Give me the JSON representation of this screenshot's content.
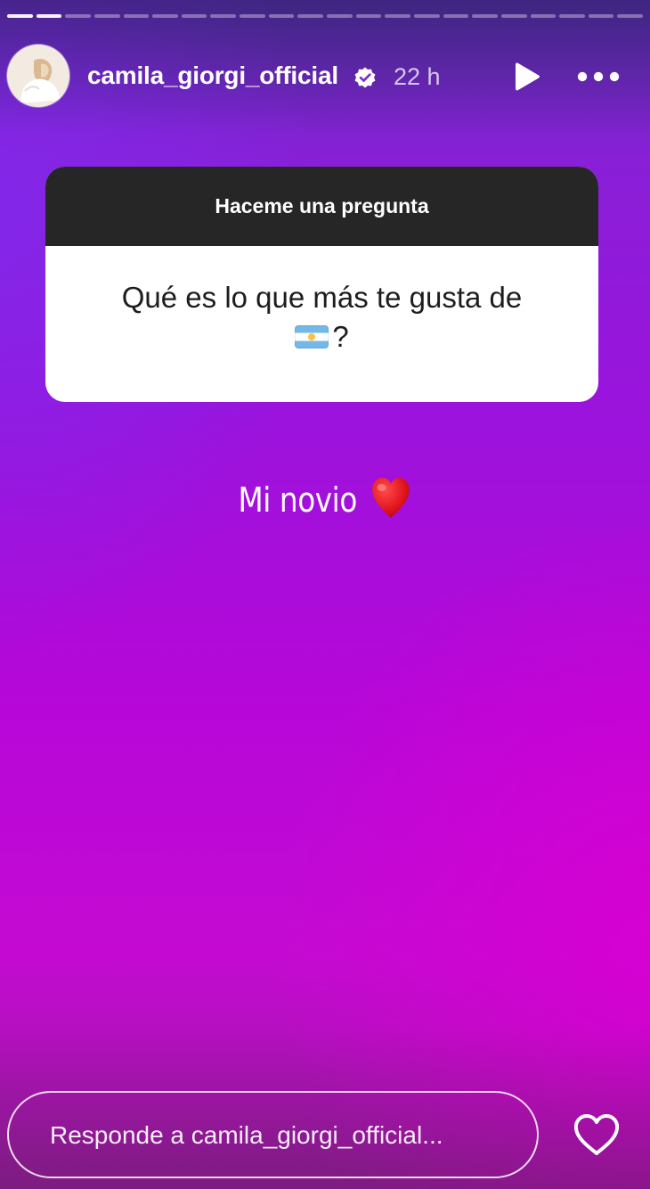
{
  "story": {
    "progress_segments": 22,
    "progress_done": 2
  },
  "header": {
    "username": "camila_giorgi_official",
    "time_ago": "22 h",
    "play_icon": "play-icon",
    "more_icon": "more-horizontal-icon",
    "verified_icon": "verified-badge-icon"
  },
  "question_sticker": {
    "title": "Haceme una pregunta",
    "question_line1": "Qué es lo que más te gusta de",
    "question_emoji": "argentina-flag-emoji",
    "question_end": "?"
  },
  "answer": {
    "text": "Mi novio",
    "emoji": "red-heart-emoji"
  },
  "footer": {
    "reply_placeholder": "Responde a camila_giorgi_official...",
    "like_icon": "heart-outline-icon"
  },
  "colors": {
    "gradient_top": "#5b2fb0",
    "gradient_mid": "#9b13dc",
    "gradient_bottom": "#c40ad2",
    "sticker_header": "#262626"
  }
}
